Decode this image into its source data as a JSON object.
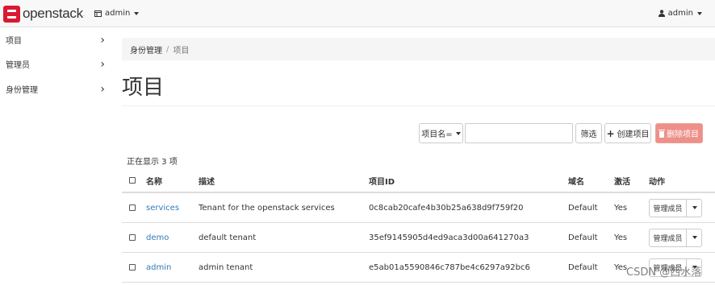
{
  "navbar": {
    "logo_text": "openstack",
    "logo_mark": ".",
    "project_label": "admin",
    "user_label": "admin"
  },
  "sidebar": {
    "items": [
      {
        "label": "项目"
      },
      {
        "label": "管理员"
      },
      {
        "label": "身份管理"
      }
    ]
  },
  "breadcrumb": {
    "parent": "身份管理",
    "separator": "/",
    "current": "项目"
  },
  "page": {
    "title": "项目"
  },
  "toolbar": {
    "filter_field": "项目名=",
    "filter_value": "",
    "filter_button": "筛选",
    "create_button": "创建项目",
    "delete_button": "删除项目"
  },
  "table": {
    "showing": "正在显示 3 项",
    "headers": {
      "name": "名称",
      "description": "描述",
      "project_id": "项目ID",
      "domain": "域名",
      "enabled": "激活",
      "actions": "动作"
    },
    "rows": [
      {
        "name": "services",
        "description": "Tenant for the openstack services",
        "project_id": "0c8cab20cafe4b30b25a638d9f759f20",
        "domain": "Default",
        "enabled": "Yes",
        "action": "管理成员"
      },
      {
        "name": "demo",
        "description": "default tenant",
        "project_id": "35ef9145905d4ed9aca3d00a641270a3",
        "domain": "Default",
        "enabled": "Yes",
        "action": "管理成员"
      },
      {
        "name": "admin",
        "description": "admin tenant",
        "project_id": "e5ab01a5590846c787be4c6297a92bc6",
        "domain": "Default",
        "enabled": "Yes",
        "action": "管理成员"
      }
    ]
  },
  "watermark": "CSDN @西水落",
  "colors": {
    "brand_red": "#da1a32",
    "link_blue": "#337ab7",
    "danger_light": "#ee8f89"
  }
}
